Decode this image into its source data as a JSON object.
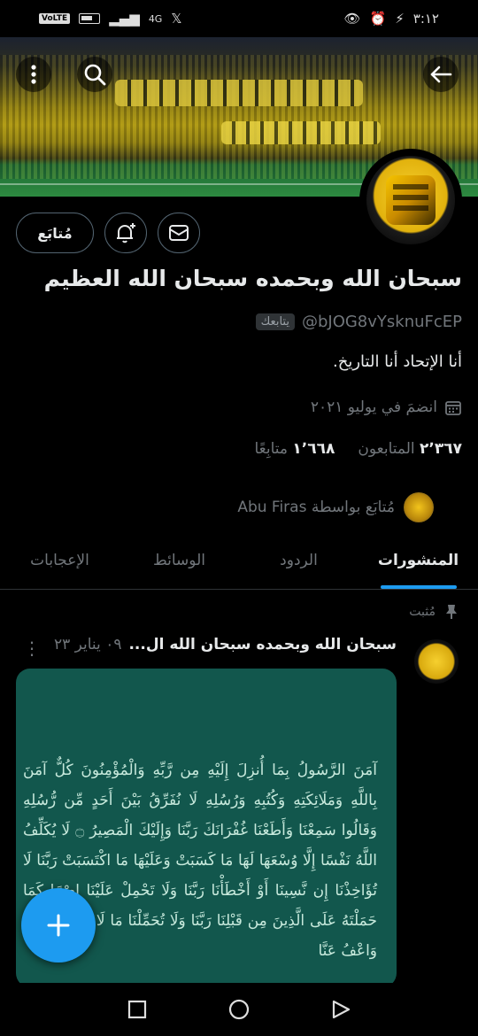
{
  "status_bar": {
    "time": "٣:١٢",
    "network": "4G",
    "volte": "VoLTE"
  },
  "header": {
    "back_icon": "arrow-left-icon",
    "search_icon": "search-icon",
    "more_icon": "more-vertical-icon"
  },
  "profile": {
    "follow_button_label": "مُتابَع",
    "notify_icon": "bell-plus-icon",
    "message_icon": "envelope-icon",
    "display_name": "سبحان الله وبحمده سبحان الله العظيم",
    "handle": "@bJOG8vYsknuFcEP",
    "follows_you_badge": "يتابعك",
    "bio": "أنا الإتحاد أنا التاريخ.",
    "joined": "انضمَ في يوليو ٢٠٢١",
    "following_count": "٢٬٣٦٧",
    "following_label": "المتابعون",
    "followers_count": "١٬٦٦٨",
    "followers_label": "متابِعًا",
    "followed_by": "مُتابَع بواسطة Abu Firas"
  },
  "tabs": [
    {
      "label": "المنشورات",
      "active": true
    },
    {
      "label": "الردود",
      "active": false
    },
    {
      "label": "الوسائط",
      "active": false
    },
    {
      "label": "الإعجابات",
      "active": false
    }
  ],
  "pinned_tweet": {
    "pinned_label": "مُثبت",
    "author_name": "سبحان الله وبحمده سبحان الله ال...",
    "date": "٠٩ يناير ٢٣",
    "media_text": "آمَنَ الرَّسُولُ بِمَا أُنزِلَ إِلَيْهِ مِن رَّبِّهِ وَالْمُؤْمِنُونَ كُلٌّ آمَنَ بِاللَّهِ وَمَلَائِكَتِهِ وَكُتُبِهِ وَرُسُلِهِ لَا نُفَرِّقُ بَيْنَ أَحَدٍ مِّن رُّسُلِهِ وَقَالُوا سَمِعْنَا وَأَطَعْنَا غُفْرَانَكَ رَبَّنَا وَإِلَيْكَ الْمَصِيرُ ۝ لَا يُكَلِّفُ اللَّهُ نَفْسًا إِلَّا وُسْعَهَا لَهَا مَا كَسَبَتْ وَعَلَيْهَا مَا اكْتَسَبَتْ رَبَّنَا لَا تُؤَاخِذْنَا إِن نَّسِينَا أَوْ أَخْطَأْنَا رَبَّنَا وَلَا تَحْمِلْ عَلَيْنَا إِصْرًا كَمَا حَمَلْتَهُ عَلَى الَّذِينَ مِن قَبْلِنَا رَبَّنَا وَلَا تُحَمِّلْنَا مَا لَا طَاقَةَ لَنَا بِهِ وَاعْفُ عَنَّا"
  },
  "fab": {
    "icon": "plus-icon"
  },
  "nav_bar": {
    "icons": [
      "square-icon",
      "circle-icon",
      "triangle-back-icon"
    ]
  },
  "colors": {
    "accent": "#1d9bf0",
    "background": "#000000",
    "muted": "#71767b",
    "media_bg": "#12574d"
  }
}
